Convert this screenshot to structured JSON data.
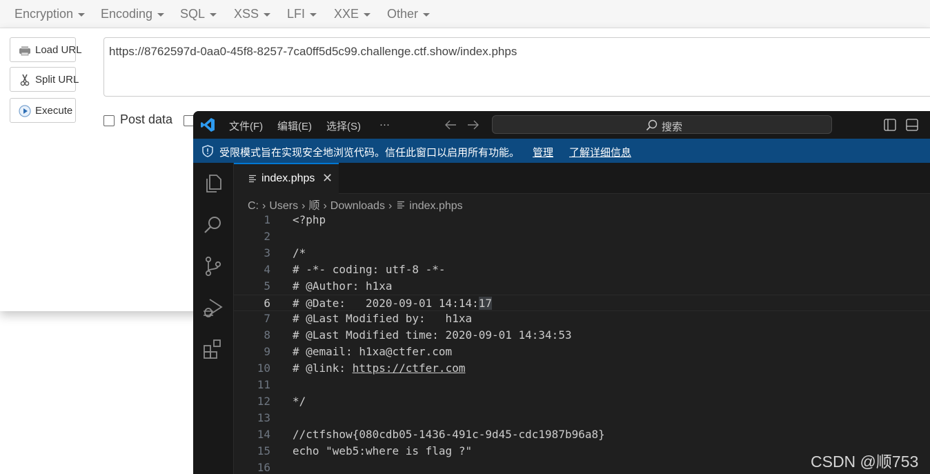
{
  "hackbar": {
    "menu": [
      {
        "label": "Encryption"
      },
      {
        "label": "Encoding"
      },
      {
        "label": "SQL"
      },
      {
        "label": "XSS"
      },
      {
        "label": "LFI"
      },
      {
        "label": "XXE"
      },
      {
        "label": "Other"
      }
    ],
    "buttons": {
      "load_url": "Load URL",
      "split_url": "Split URL",
      "execute": "Execute"
    },
    "url_value": "https://8762597d-0aa0-45f8-8257-7ca0ff5d5c99.challenge.ctf.show/index.phps",
    "post_data_label": "Post data"
  },
  "vscode": {
    "menu": [
      "文件(F)",
      "编辑(E)",
      "选择(S)",
      "···"
    ],
    "search_placeholder": "搜索",
    "banner": {
      "text": "受限模式旨在实现安全地浏览代码。信任此窗口以启用所有功能。",
      "manage": "管理",
      "learn_more": "了解详细信息"
    },
    "tab": {
      "label": "index.phps",
      "close": "✕"
    },
    "breadcrumb": [
      "C:",
      "Users",
      "顺",
      "Downloads",
      "index.phps"
    ],
    "active_line": 6,
    "lines": [
      {
        "num": "1",
        "text": "<?php"
      },
      {
        "num": "2",
        "text": ""
      },
      {
        "num": "3",
        "text": "/*"
      },
      {
        "num": "4",
        "text": "# -*- coding: utf-8 -*-"
      },
      {
        "num": "5",
        "text": "# @Author: h1xa"
      },
      {
        "num": "6",
        "text": "# @Date:   2020-09-01 14:14:",
        "highlight": "17"
      },
      {
        "num": "7",
        "text": "# @Last Modified by:   h1xa"
      },
      {
        "num": "8",
        "text": "# @Last Modified time: 2020-09-01 14:34:53"
      },
      {
        "num": "9",
        "text": "# @email: h1xa@ctfer.com"
      },
      {
        "num": "10",
        "text": "# @link: ",
        "link": "https://ctfer.com"
      },
      {
        "num": "11",
        "text": ""
      },
      {
        "num": "12",
        "text": "*/"
      },
      {
        "num": "13",
        "text": ""
      },
      {
        "num": "14",
        "text": "//ctfshow{080cdb05-1436-491c-9d45-cdc1987b96a8}"
      },
      {
        "num": "15",
        "text": "echo \"web5:where is flag ?\""
      },
      {
        "num": "16",
        "text": ""
      }
    ]
  },
  "watermark": "CSDN @顺753"
}
